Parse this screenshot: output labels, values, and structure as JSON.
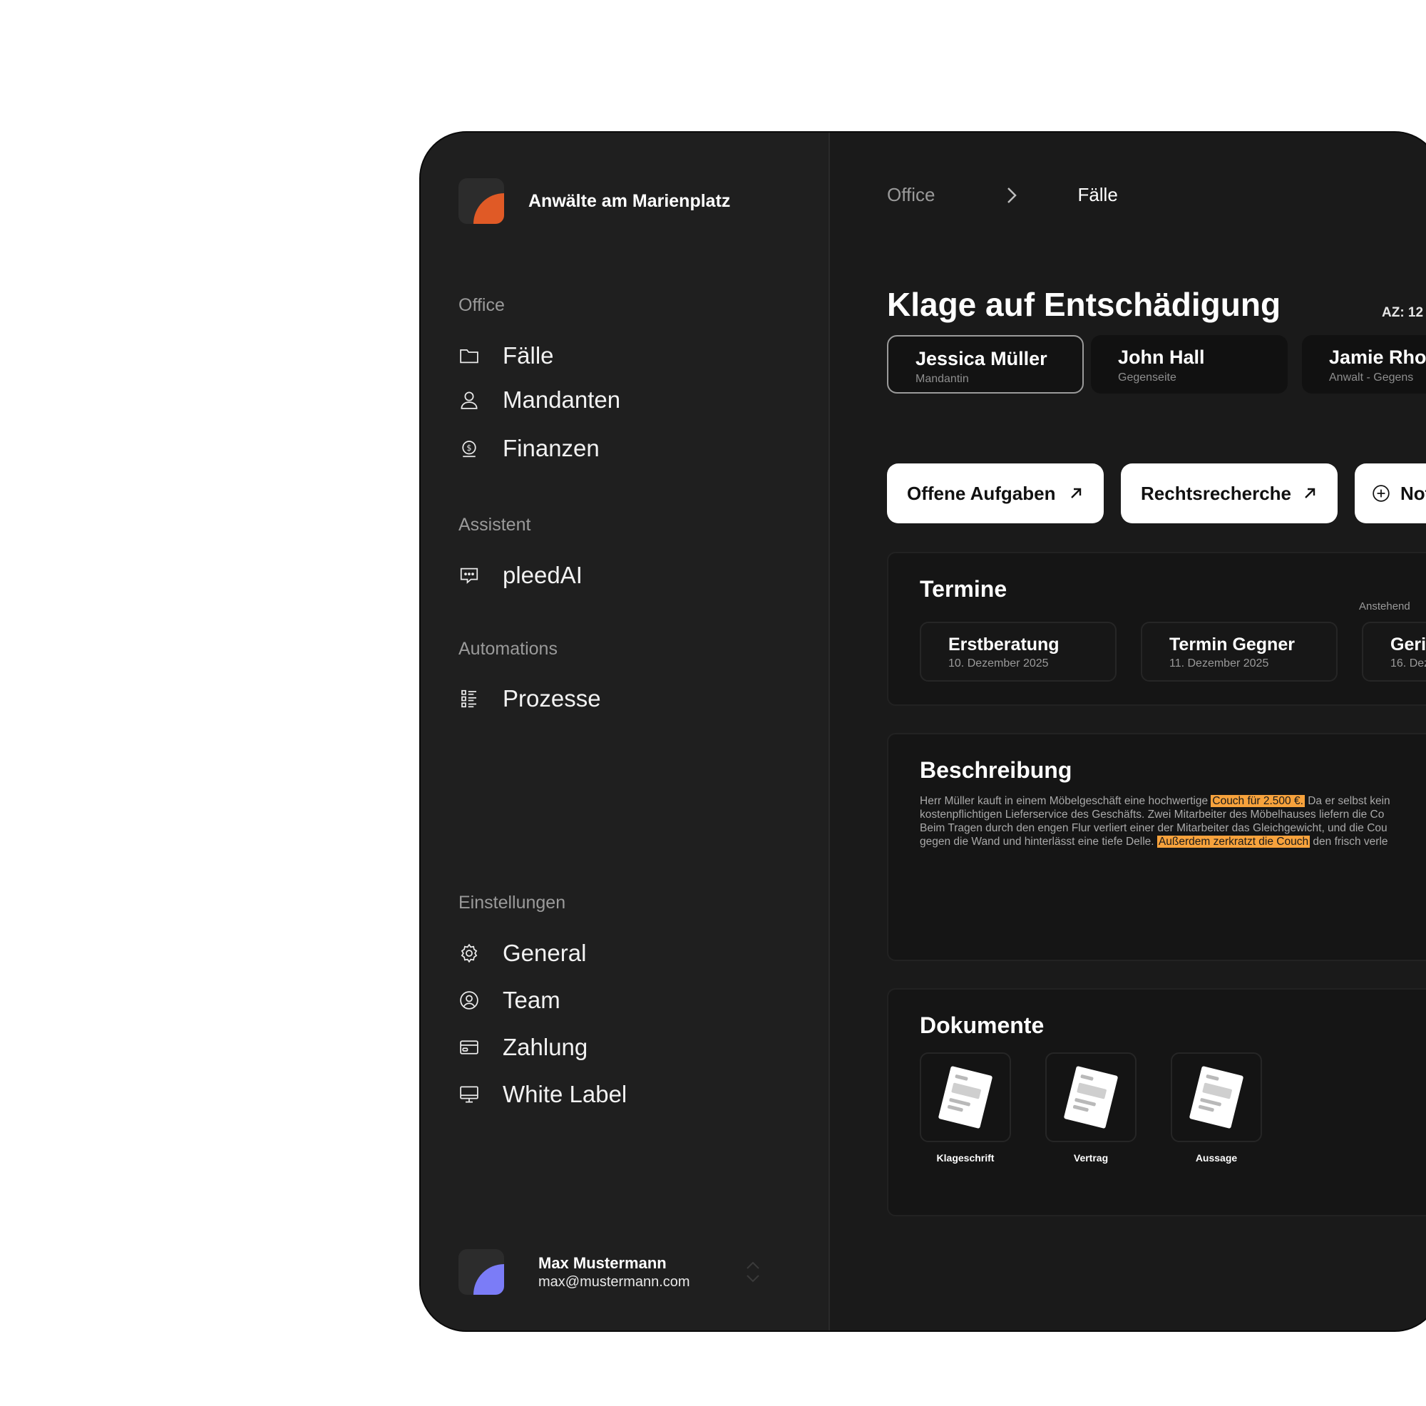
{
  "sidebar": {
    "brand": "Anwälte am Marienplatz",
    "sections": {
      "office": "Office",
      "assistant": "Assistent",
      "automations": "Automations",
      "settings": "Einstellungen"
    },
    "items": {
      "faelle": "Fälle",
      "mandanten": "Mandanten",
      "finanzen": "Finanzen",
      "pleedai": "pleedAI",
      "prozesse": "Prozesse",
      "general": "General",
      "team": "Team",
      "zahlung": "Zahlung",
      "white_label": "White Label"
    },
    "user": {
      "name": "Max Mustermann",
      "email": "max@mustermann.com"
    }
  },
  "main": {
    "breadcrumb": {
      "root": "Office",
      "current": "Fälle"
    },
    "title": "Klage auf Entschädigung",
    "case_number": "AZ: 12",
    "parties": [
      {
        "name": "Jessica Müller",
        "role": "Mandantin"
      },
      {
        "name": "John Hall",
        "role": "Gegenseite"
      },
      {
        "name": "Jamie Rho",
        "role": "Anwalt - Gegens"
      }
    ],
    "actions": {
      "open_tasks": "Offene Aufgaben",
      "legal_research": "Rechtsrecherche",
      "notes": "Not"
    },
    "termine": {
      "title": "Termine",
      "upcoming_label": "Anstehend",
      "items": [
        {
          "name": "Erstberatung",
          "date": "10. Dezember 2025"
        },
        {
          "name": "Termin Gegner",
          "date": "11. Dezember 2025"
        },
        {
          "name": "Geric",
          "date": "16. Dez"
        }
      ]
    },
    "beschreibung": {
      "title": "Beschreibung",
      "line1_a": "Herr Müller kauft in einem Möbelgeschäft eine hochwertige",
      "line1_hl": "Couch für 2.500 €.",
      "line1_b": "Da er selbst kein",
      "line2": "kostenpflichtigen Lieferservice des Geschäfts. Zwei Mitarbeiter des Möbelhauses liefern die Co",
      "line3": "Beim Tragen durch den engen Flur verliert einer der Mitarbeiter das Gleichgewicht, und die Cou",
      "line4_a": "gegen die Wand und hinterlässt eine tiefe Delle.",
      "line4_hl": "Außerdem zerkratzt die Couch",
      "line4_b": "den frisch verle"
    },
    "dokumente": {
      "title": "Dokumente",
      "items": [
        "Klageschrift",
        "Vertrag",
        "Aussage"
      ]
    }
  },
  "colors": {
    "brand_logo": "#e05a26",
    "user_avatar": "#7b7cf7",
    "highlight": "#f7a23c"
  }
}
